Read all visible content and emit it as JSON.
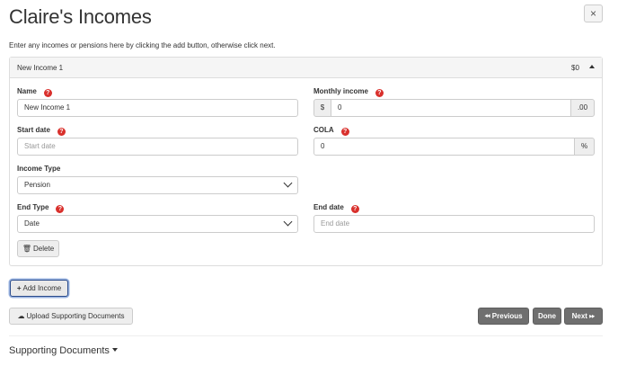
{
  "header": {
    "title": "Claire's Incomes",
    "close_label": "×"
  },
  "intro_text": "Enter any incomes or pensions here by clicking the add button, otherwise click next.",
  "income_panel": {
    "title": "New Income 1",
    "amount": "$0",
    "fields": {
      "name": {
        "label": "Name",
        "value": "New Income 1"
      },
      "monthly_income": {
        "label": "Monthly income",
        "prefix": "$",
        "value": "0",
        "suffix": ".00"
      },
      "start_date": {
        "label": "Start date",
        "placeholder": "Start date"
      },
      "cola": {
        "label": "COLA",
        "value": "0",
        "suffix": "%"
      },
      "income_type": {
        "label": "Income Type",
        "selected": "Pension"
      },
      "end_type": {
        "label": "End Type",
        "selected": "Date"
      },
      "end_date": {
        "label": "End date",
        "placeholder": "End date"
      }
    },
    "delete_label": "Delete"
  },
  "buttons": {
    "add_income": "Add Income",
    "upload_docs": "Upload Supporting Documents",
    "previous": "Previous",
    "done": "Done",
    "next": "Next"
  },
  "supporting_documents": {
    "title": "Supporting Documents"
  },
  "icons": {
    "help": "question-circle-icon",
    "plus": "plus-icon",
    "trash": "trash-icon",
    "cloud_upload": "cloud-upload-icon",
    "backward": "backward-icon",
    "forward": "forward-icon",
    "chevron": "chevron-down-icon"
  },
  "colors": {
    "help_red": "#d9302c",
    "nav_button": "#6f6f6f",
    "focus_border": "#2b4c8c"
  }
}
